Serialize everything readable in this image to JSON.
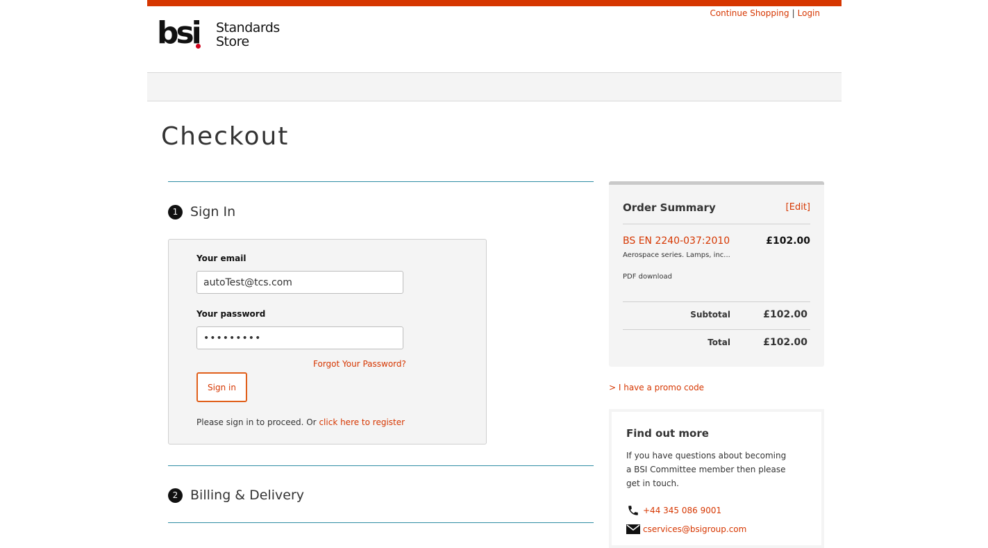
{
  "header": {
    "logo_mark": "bsi",
    "logo_text_line1": "Standards",
    "logo_text_line2": "Store",
    "continue_shopping": "Continue Shopping",
    "separator": "|",
    "login": "Login",
    "accent_color": "#d63600"
  },
  "page": {
    "title": "Checkout"
  },
  "steps": [
    {
      "number": "1",
      "label": "Sign In"
    },
    {
      "number": "2",
      "label": "Billing & Delivery"
    }
  ],
  "signin": {
    "email_label": "Your email",
    "email_value": "autoTest@tcs.com",
    "password_label": "Your password",
    "password_value": "•••••••••",
    "forgot_link": "Forgot Your Password?",
    "button_label": "Sign in",
    "proceed_text": "Please sign in to proceed. Or",
    "register_link": "click here to register"
  },
  "order_summary": {
    "title": "Order Summary",
    "edit_link": "[Edit]",
    "product_code": "BS EN 2240-037:2010",
    "product_price": "£102.00",
    "product_desc": "Aerospace series. Lamps, inc...",
    "product_format": "PDF download",
    "subtotal_label": "Subtotal",
    "subtotal_value": "£102.00",
    "total_label": "Total",
    "total_value": "£102.00"
  },
  "promo_link": "> I have a promo code",
  "find_out_more": {
    "title": "Find out more",
    "text": "If you have questions about becoming a BSI Committee member then please get in touch.",
    "phone": "+44 345 086 9001",
    "email": "cservices@bsigroup.com",
    "phone_icon": "phone-icon",
    "email_icon": "envelope-icon"
  }
}
